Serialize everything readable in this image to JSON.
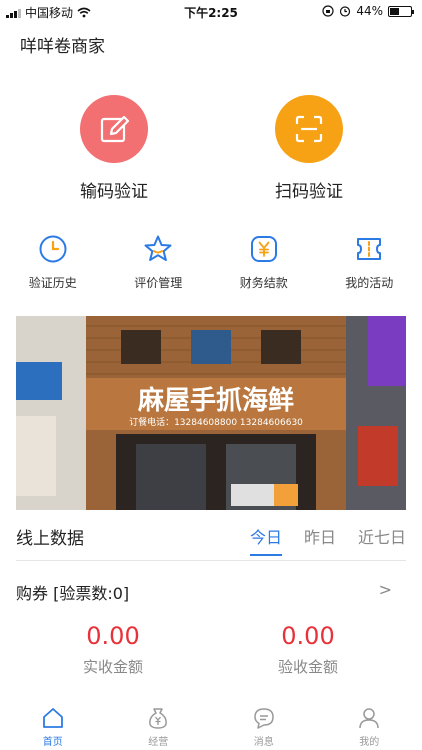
{
  "status_bar": {
    "carrier": "中国移动",
    "time": "下午2:25",
    "battery": "44%",
    "battery_level": 0.44
  },
  "shop_name": "咩咩卷商家",
  "big_actions": [
    {
      "label": "输码验证",
      "icon": "edit-icon",
      "color": "#f26f72"
    },
    {
      "label": "扫码验证",
      "icon": "scan-icon",
      "color": "#f7a115"
    }
  ],
  "small_actions": [
    {
      "label": "验证历史",
      "icon": "clock-icon"
    },
    {
      "label": "评价管理",
      "icon": "star-icon"
    },
    {
      "label": "财务结款",
      "icon": "yen-icon"
    },
    {
      "label": "我的活动",
      "icon": "ticket-icon"
    }
  ],
  "banner": {
    "sign_text": "麻屋手抓海鲜",
    "phone_text": "订餐电话：13284608800  13284606630"
  },
  "online_data": {
    "title": "线上数据",
    "tabs": [
      "今日",
      "昨日",
      "近七日"
    ],
    "active_tab": "今日",
    "coupon_label": "购券 [验票数:0]",
    "chevron": ">",
    "stats": [
      {
        "value": "0.00",
        "caption": "实收金额"
      },
      {
        "value": "0.00",
        "caption": "验收金额"
      }
    ]
  },
  "tabbar": [
    {
      "label": "首页",
      "icon": "home-icon",
      "active": true
    },
    {
      "label": "经营",
      "icon": "money-bag-icon",
      "active": false
    },
    {
      "label": "消息",
      "icon": "message-icon",
      "active": false
    },
    {
      "label": "我的",
      "icon": "user-icon",
      "active": false
    }
  ],
  "colors": {
    "accent": "#2c7be5",
    "amount": "#e8323a"
  }
}
